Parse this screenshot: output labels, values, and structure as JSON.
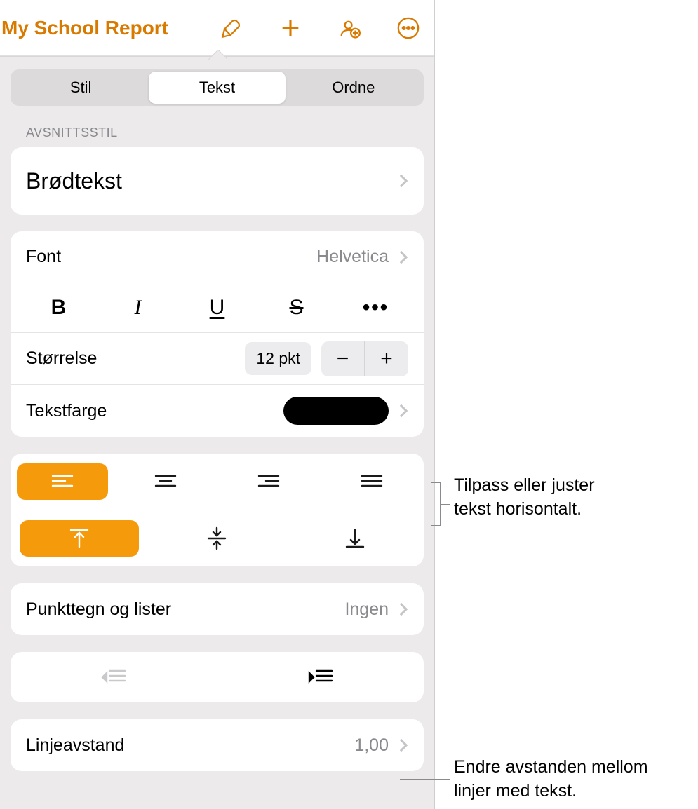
{
  "toolbar": {
    "doc_title": "My School Report"
  },
  "tabs": {
    "style": "Stil",
    "text": "Tekst",
    "arrange": "Ordne"
  },
  "section": {
    "paragraph_style": "AVSNITTSSTIL"
  },
  "paragraph_style_value": "Brødtekst",
  "font": {
    "label": "Font",
    "value": "Helvetica"
  },
  "format_buttons": {
    "bold": "B",
    "italic": "I",
    "underline": "U",
    "strike": "S",
    "more": "•••"
  },
  "size": {
    "label": "Størrelse",
    "value": "12 pkt",
    "minus": "−",
    "plus": "+"
  },
  "text_color": {
    "label": "Tekstfarge",
    "value": "#000000"
  },
  "bullets": {
    "label": "Punkttegn og lister",
    "value": "Ingen"
  },
  "line_spacing": {
    "label": "Linjeavstand",
    "value": "1,00"
  },
  "callouts": {
    "horizontal_align": "Tilpass eller juster\ntekst horisontalt.",
    "line_spacing": "Endre avstanden mellom\nlinjer med tekst."
  }
}
